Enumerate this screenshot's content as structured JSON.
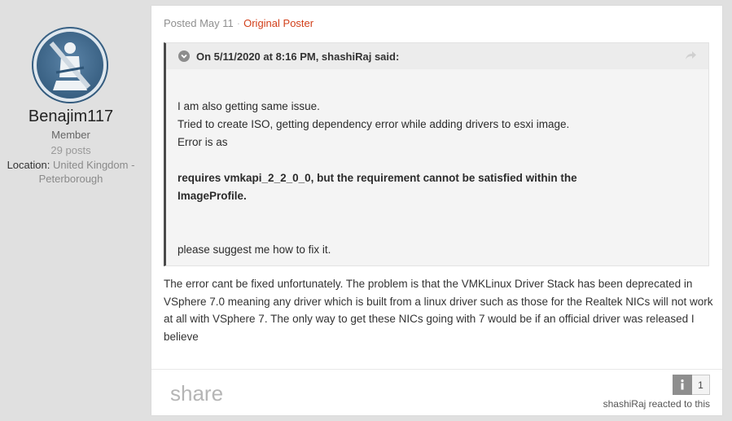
{
  "author": {
    "name": "Benajim117",
    "role": "Member",
    "posts": "29 posts",
    "location_label": "Location:",
    "location_value": "United Kingdom - Peterborough"
  },
  "post": {
    "date": "Posted May 11",
    "separator": "·",
    "badge": "Original Poster",
    "quote": {
      "citation": "On 5/11/2020 at 8:16 PM, shashiRaj said:",
      "lines": [
        "I am also getting same issue.",
        "Tried to create ISO, getting dependency error while adding drivers to esxi image.",
        "Error is as"
      ],
      "bold_error": "requires vmkapi_2_2_0_0, but the requirement cannot be satisfied within the ImageProfile.",
      "closing": "please suggest me how to fix it."
    },
    "body": "The error cant be fixed unfortunately. The problem is that the VMKLinux Driver Stack has been deprecated in VSphere 7.0 meaning any driver which is built from a linux driver such as those for the Realtek NICs will not work at all with VSphere 7. The only way to get these NICs going with 7 would be if an official driver was released I believe"
  },
  "footer": {
    "share_label": "share",
    "reaction_icon": "info-icon",
    "reaction_count": "1",
    "reacted_by": "shashiRaj reacted to this"
  },
  "colors": {
    "accent_op": "#d2401b",
    "quote_border": "#4a4a4a",
    "page_bg": "#e0e0e0"
  }
}
